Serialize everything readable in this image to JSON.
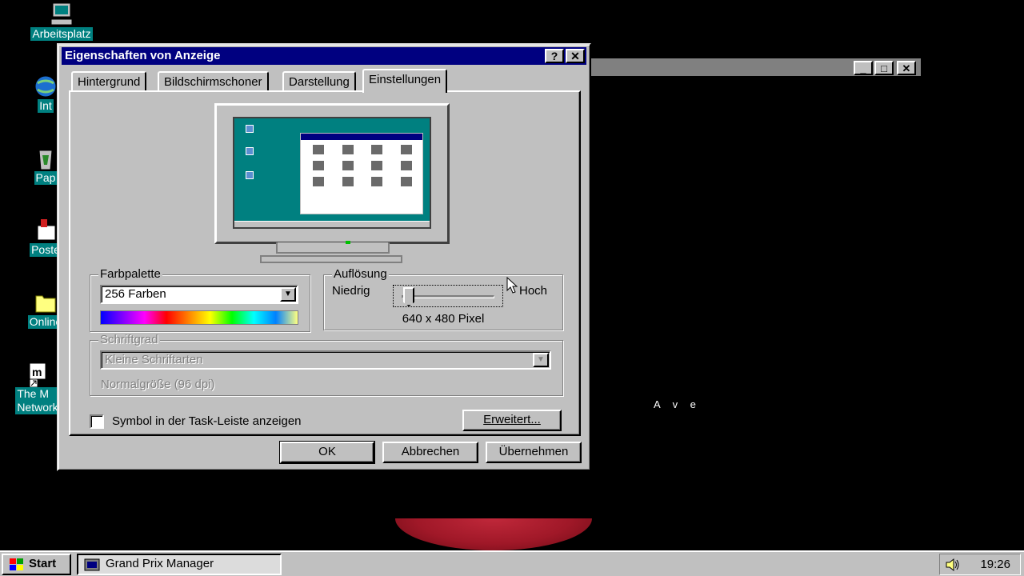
{
  "desktop": {
    "icons": [
      {
        "label": "Arbeitsplatz"
      },
      {
        "label": "Int"
      },
      {
        "label": "Pap"
      },
      {
        "label": "Poste"
      },
      {
        "label": "Online"
      },
      {
        "label": "The M\nNetwork"
      }
    ]
  },
  "game_window": {
    "minimize": "_",
    "maximize": "□",
    "close": "✕",
    "overlay_text": "A v e"
  },
  "dialog": {
    "title": "Eigenschaften von Anzeige",
    "help_button": "?",
    "close_button": "✕",
    "tabs": [
      {
        "label": "Hintergrund"
      },
      {
        "label": "Bildschirmschoner"
      },
      {
        "label": "Darstellung"
      },
      {
        "label": "Einstellungen"
      }
    ],
    "active_tab": "Einstellungen",
    "farbpalette": {
      "title": "Farbpalette",
      "selected": "256 Farben"
    },
    "aufloesung": {
      "title": "Auflösung",
      "low_label": "Niedrig",
      "high_label": "Hoch",
      "value_text": "640 x 480 Pixel",
      "slider_level": 0
    },
    "schriftgrad": {
      "title": "Schriftgrad",
      "selected": "Kleine Schriftarten",
      "note": "Normalgröße (96 dpi)"
    },
    "taskbar_checkbox": {
      "label": "Symbol in der Task-Leiste anzeigen",
      "checked": false
    },
    "advanced_button": "Erweitert...",
    "ok_button": "OK",
    "cancel_button": "Abbrechen",
    "apply_button": "Übernehmen"
  },
  "taskbar": {
    "start_label": "Start",
    "tasks": [
      {
        "label": "Grand Prix Manager"
      }
    ],
    "clock": "19:26"
  },
  "colors": {
    "title_bar": "#000080",
    "desktop_label_bg": "#008080",
    "dialog_face": "#c0c0c0"
  }
}
